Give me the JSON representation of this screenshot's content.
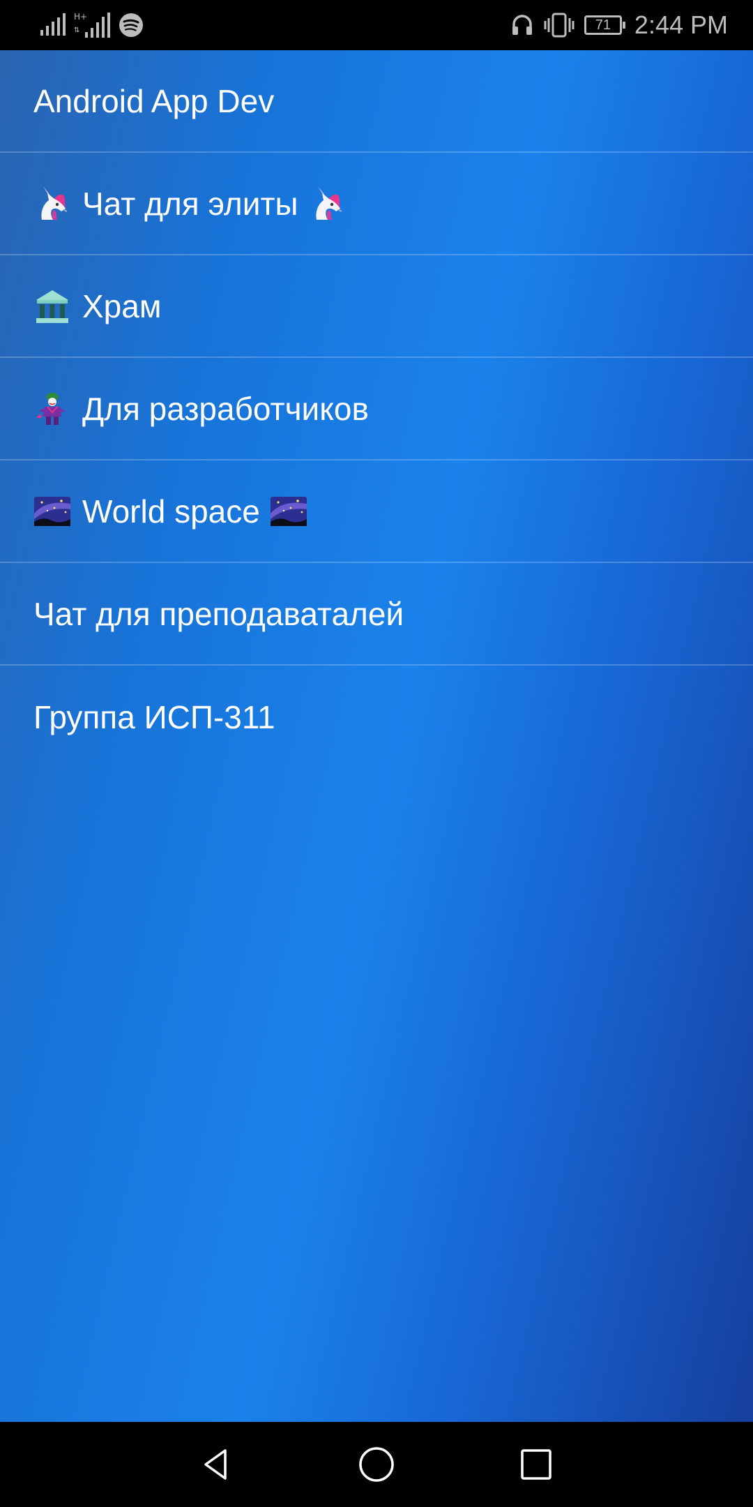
{
  "status_bar": {
    "time": "2:44 PM",
    "battery_level": "71",
    "icons": [
      "signal-icon",
      "signal-hplus-icon",
      "spotify-icon",
      "headphones-icon",
      "vibrate-icon",
      "battery-icon"
    ]
  },
  "chats": [
    {
      "title": "Android App Dev",
      "lead_icon": "",
      "trail_icon": ""
    },
    {
      "title": "Чат для элиты",
      "lead_icon": "unicorn-icon",
      "trail_icon": "unicorn-icon"
    },
    {
      "title": "Храм",
      "lead_icon": "classical-building-icon",
      "trail_icon": ""
    },
    {
      "title": "Для разработчиков",
      "lead_icon": "joker-icon",
      "trail_icon": ""
    },
    {
      "title": "World space",
      "lead_icon": "milky-way-icon",
      "trail_icon": "milky-way-icon"
    },
    {
      "title": "Чат для преподаваталей",
      "lead_icon": "",
      "trail_icon": ""
    },
    {
      "title": "Группа ИСП-311",
      "lead_icon": "",
      "trail_icon": ""
    }
  ],
  "nav_bar": {
    "buttons": [
      "back-icon",
      "home-icon",
      "recents-icon"
    ]
  },
  "colors": {
    "gradient_dark": "#163f9e",
    "gradient_light": "#1a82ea",
    "status_text": "#bdbdbd"
  }
}
